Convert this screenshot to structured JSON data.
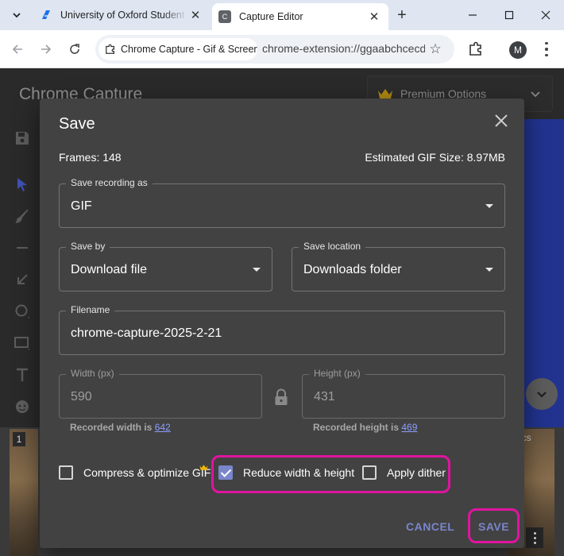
{
  "browser": {
    "tabs": [
      {
        "title": "University of Oxford Student",
        "close": "✕"
      },
      {
        "title": "Capture Editor",
        "favicon_letter": "C",
        "close": "✕"
      }
    ],
    "new_tab": "+",
    "site_chip": "Chrome Capture - Gif & Screen",
    "url": "chrome-extension://ggaabchcecdbomdcnmahdfddnnedkgpd",
    "star": "☆",
    "avatar_letter": "M"
  },
  "app": {
    "title": "Chrome Capture",
    "premium_label": "Premium Options",
    "frame_number": "1",
    "secs_label": "ecs"
  },
  "dialog": {
    "title": "Save",
    "frames_label": "Frames: 148",
    "estimated_size_label": "Estimated GIF Size: 8.97MB",
    "save_as": {
      "label": "Save recording as",
      "value": "GIF"
    },
    "save_by": {
      "label": "Save by",
      "value": "Download file"
    },
    "save_location": {
      "label": "Save location",
      "value": "Downloads folder"
    },
    "filename": {
      "label": "Filename",
      "value": "chrome-capture-2025-2-21"
    },
    "width": {
      "label": "Width (px)",
      "value": "590"
    },
    "height": {
      "label": "Height (px)",
      "value": "431"
    },
    "recorded_width": {
      "text": "Recorded width is",
      "value": "642"
    },
    "recorded_height": {
      "text": "Recorded height is",
      "value": "469"
    },
    "options": {
      "compress": {
        "label": "Compress & optimize GIF",
        "checked": false
      },
      "reduce": {
        "label": "Reduce width & height",
        "checked": true
      },
      "dither": {
        "label": "Apply dither",
        "checked": false
      }
    },
    "cancel_label": "CANCEL",
    "save_label": "SAVE"
  },
  "colors": {
    "accent": "#7986cb",
    "highlight": "#e0149f",
    "dialog_bg": "#424242",
    "crown": "#f2b705"
  }
}
